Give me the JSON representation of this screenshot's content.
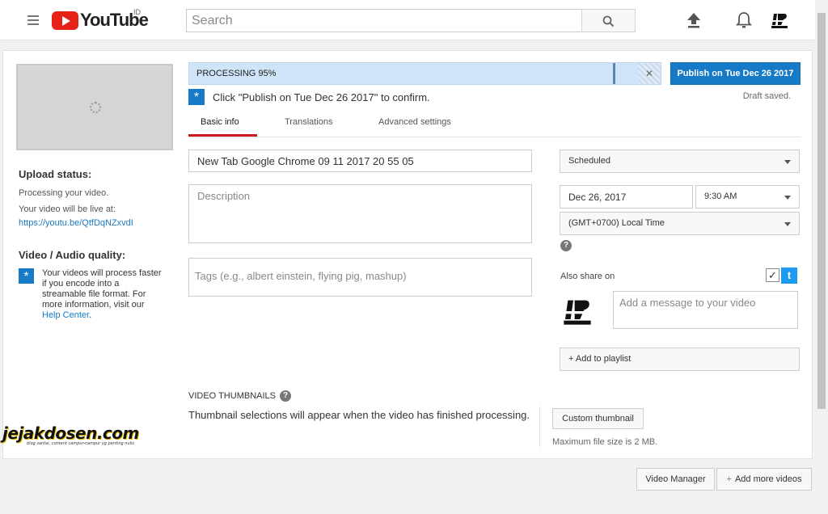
{
  "header": {
    "logo_text": "YouTube",
    "country_code": "ID",
    "search_placeholder": "Search"
  },
  "upload": {
    "processing_label": "PROCESSING 95%",
    "progress_pct": 95,
    "publish_button": "Publish on Tue Dec 26 2017",
    "confirm_text": "Click \"Publish on Tue Dec 26 2017\" to confirm.",
    "draft_status": "Draft saved."
  },
  "tabs": [
    "Basic info",
    "Translations",
    "Advanced settings"
  ],
  "sidebar": {
    "status_heading": "Upload status:",
    "status_text": "Processing your video.",
    "live_text": "Your video will be live at:",
    "video_url": "https://youtu.be/QtfDqNZxvdI",
    "quality_heading": "Video / Audio quality:",
    "quality_text": "Your videos will process faster if you encode into a streamable file format. For more information, visit our",
    "help_center": "Help Center",
    "help_center_suffix": "."
  },
  "form": {
    "title_value": "New Tab   Google Chrome 09 11 2017 20 55 05",
    "description_placeholder": "Description",
    "tags_placeholder": "Tags (e.g., albert einstein, flying pig, mashup)"
  },
  "schedule": {
    "visibility": "Scheduled",
    "date": "Dec 26, 2017",
    "time": "9:30 AM",
    "timezone": "(GMT+0700) Local Time",
    "also_share": "Also share on",
    "message_placeholder": "Add a message to your video",
    "playlist_button": "+ Add to playlist",
    "twitter_checked": true
  },
  "thumbnails": {
    "heading": "VIDEO THUMBNAILS",
    "message": "Thumbnail selections will appear when the video has finished processing.",
    "custom_button": "Custom thumbnail",
    "max_size": "Maximum file size is 2 MB."
  },
  "footer": {
    "video_manager": "Video Manager",
    "add_more": "Add more videos"
  },
  "watermark": {
    "main": "jejakdosen.com",
    "sub": "blog santai, content campur-campur yg penting nulis"
  },
  "colors": {
    "brand_red": "#e62117",
    "accent_blue": "#167ac6",
    "processing_bg": "#cfe4f8"
  }
}
